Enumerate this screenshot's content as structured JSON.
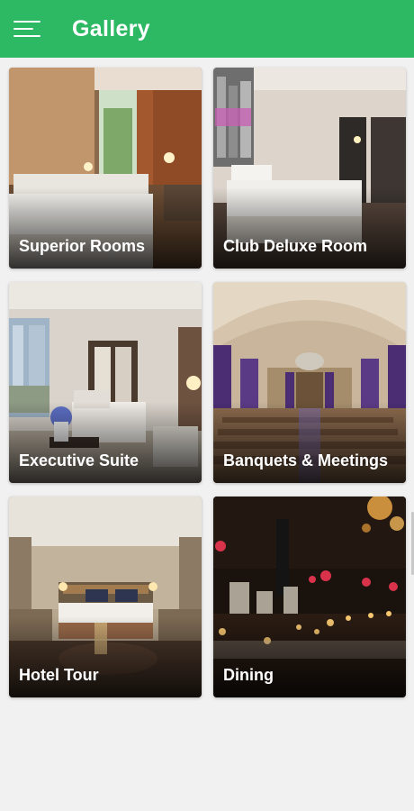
{
  "header": {
    "title": "Gallery",
    "menu_icon": "hamburger-menu-icon",
    "color": "#2db864"
  },
  "gallery": {
    "items": [
      {
        "label": "Superior Rooms"
      },
      {
        "label": "Club Deluxe Room"
      },
      {
        "label": "Executive Suite"
      },
      {
        "label": "Banquets & Meetings"
      },
      {
        "label": "Hotel Tour"
      },
      {
        "label": "Dining"
      }
    ]
  }
}
